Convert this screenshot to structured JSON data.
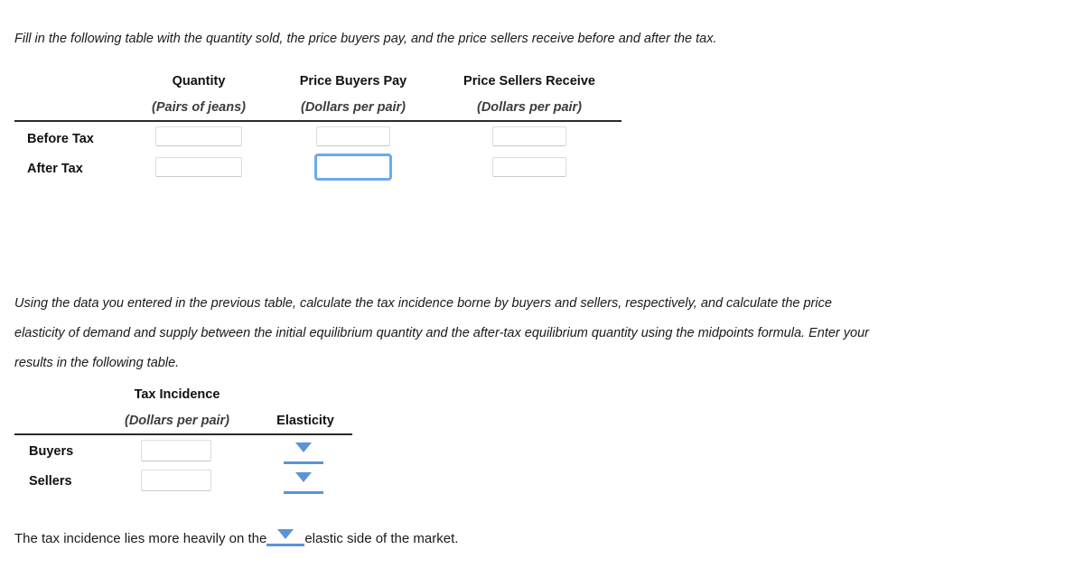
{
  "prompt1": "Fill in the following table with the quantity sold, the price buyers pay, and the price sellers receive before and after the tax.",
  "paragraph2": {
    "line1": "Using the data you entered in the previous table, calculate the tax incidence borne by buyers and sellers, respectively, and calculate the price",
    "line2": "elasticity of demand and supply between the initial equilibrium quantity and the after-tax equilibrium quantity using the midpoints formula. Enter your",
    "line3": "results in the following table."
  },
  "table1": {
    "columns": [
      {
        "title": "Quantity",
        "subtitle": "(Pairs of jeans)"
      },
      {
        "title": "Price Buyers Pay",
        "subtitle": "(Dollars per pair)"
      },
      {
        "title": "Price Sellers Receive",
        "subtitle": "(Dollars per pair)"
      }
    ],
    "rows": [
      {
        "label": "Before Tax",
        "cells": [
          {
            "value": "",
            "focused": false
          },
          {
            "value": "",
            "focused": false
          },
          {
            "value": "",
            "focused": false
          }
        ]
      },
      {
        "label": "After Tax",
        "cells": [
          {
            "value": "",
            "focused": false
          },
          {
            "value": "",
            "focused": true
          },
          {
            "value": "",
            "focused": false
          }
        ]
      }
    ]
  },
  "table2": {
    "columns": [
      {
        "title": "Tax Incidence",
        "subtitle": "(Dollars per pair)"
      },
      {
        "title": "Elasticity",
        "subtitle": ""
      }
    ],
    "rows": [
      {
        "label": "Buyers",
        "value": "",
        "elasticity_selected": ""
      },
      {
        "label": "Sellers",
        "value": "",
        "elasticity_selected": ""
      }
    ]
  },
  "closing": {
    "before": "The tax incidence lies more heavily on the",
    "selected": "",
    "after": "elastic side of the market."
  },
  "colors": {
    "accent_blue": "#5b93d6",
    "focus_blue": "#6aa9f4",
    "rule": "#2b2b2b",
    "input_border": "#dcdcdc",
    "text": "#1a1a1a",
    "subheader_text": "#3d3d3d"
  },
  "icons": {
    "dropdown": "chevron-down-icon"
  }
}
